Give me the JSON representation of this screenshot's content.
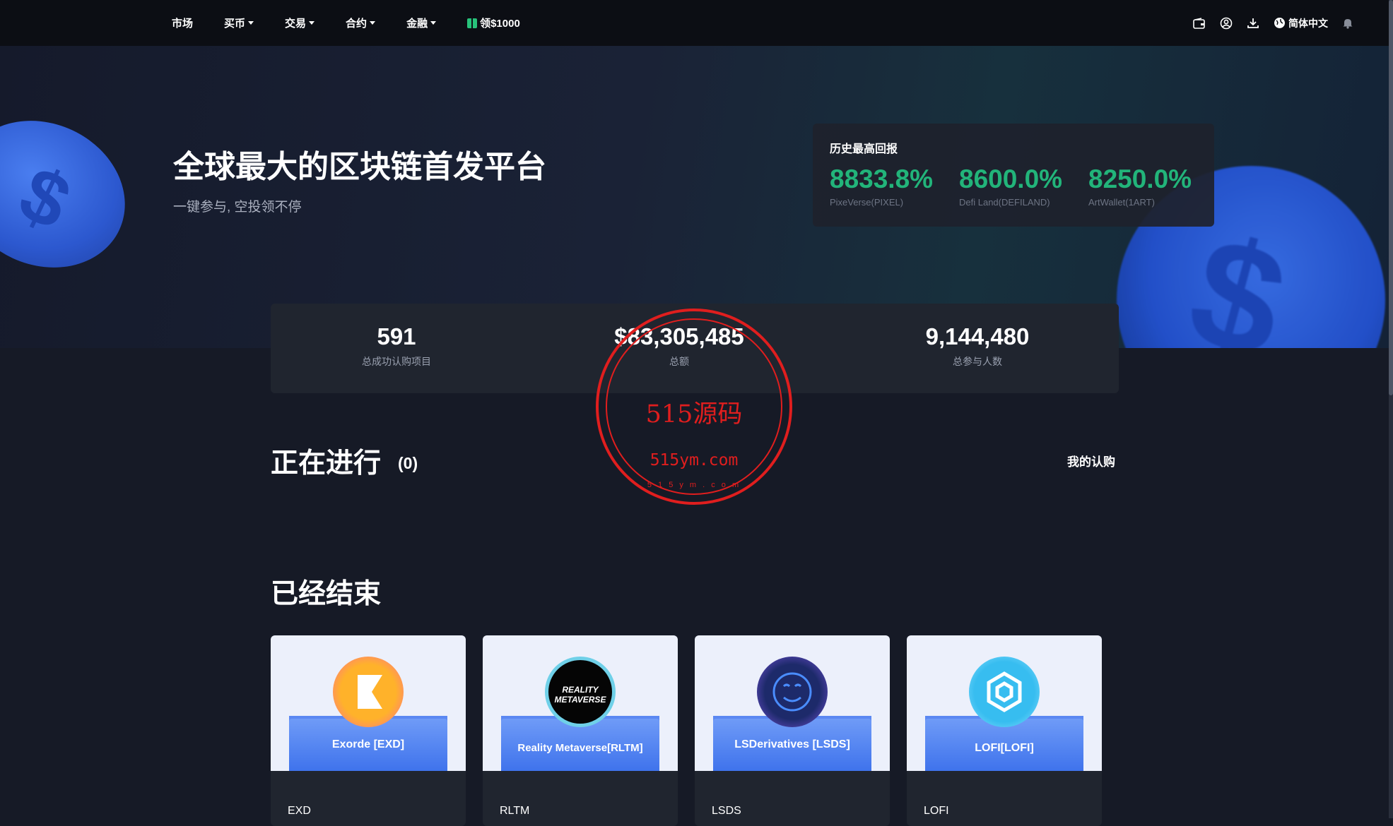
{
  "nav": {
    "items": [
      {
        "label": "市场",
        "dropdown": false
      },
      {
        "label": "买币",
        "dropdown": true
      },
      {
        "label": "交易",
        "dropdown": true
      },
      {
        "label": "合约",
        "dropdown": true
      },
      {
        "label": "金融",
        "dropdown": true
      }
    ],
    "promo": "领$1000",
    "language": "简体中文",
    "icons": [
      "wallet-icon",
      "user-icon",
      "download-icon",
      "globe-icon",
      "bell-icon"
    ]
  },
  "hero": {
    "title": "全球最大的区块链首发平台",
    "subtitle": "一键参与, 空投领不停"
  },
  "returns": {
    "title": "历史最高回报",
    "items": [
      {
        "value": "8833.8%",
        "name": "PixeVerse(PIXEL)"
      },
      {
        "value": "8600.0%",
        "name": "Defi Land(DEFILAND)"
      },
      {
        "value": "8250.0%",
        "name": "ArtWallet(1ART)"
      }
    ]
  },
  "stats": [
    {
      "value": "591",
      "label": "总成功认购项目"
    },
    {
      "value": "$83,305,485",
      "label": "总额"
    },
    {
      "value": "9,144,480",
      "label": "总参与人数"
    }
  ],
  "ongoing": {
    "title": "正在进行",
    "count": "(0)",
    "my_subscriptions": "我的认购"
  },
  "ended": {
    "title": "已经结束",
    "cards": [
      {
        "label": "Exorde [EXD]",
        "symbol": "EXD"
      },
      {
        "label": "Reality Metaverse[RLTM]",
        "symbol": "RLTM",
        "logo_text": "REALITY METAVERSE"
      },
      {
        "label": "LSDerivatives [LSDS]",
        "symbol": "LSDS"
      },
      {
        "label": "LOFI[LOFI]",
        "symbol": "LOFI"
      }
    ]
  },
  "watermark": {
    "main": "515源码",
    "url": "515ym.com",
    "ring": "5 1 5 y m . c o m"
  },
  "colors": {
    "accent_green": "#22b47a",
    "stamp_red": "#e01e1e",
    "background": "#161a26"
  }
}
